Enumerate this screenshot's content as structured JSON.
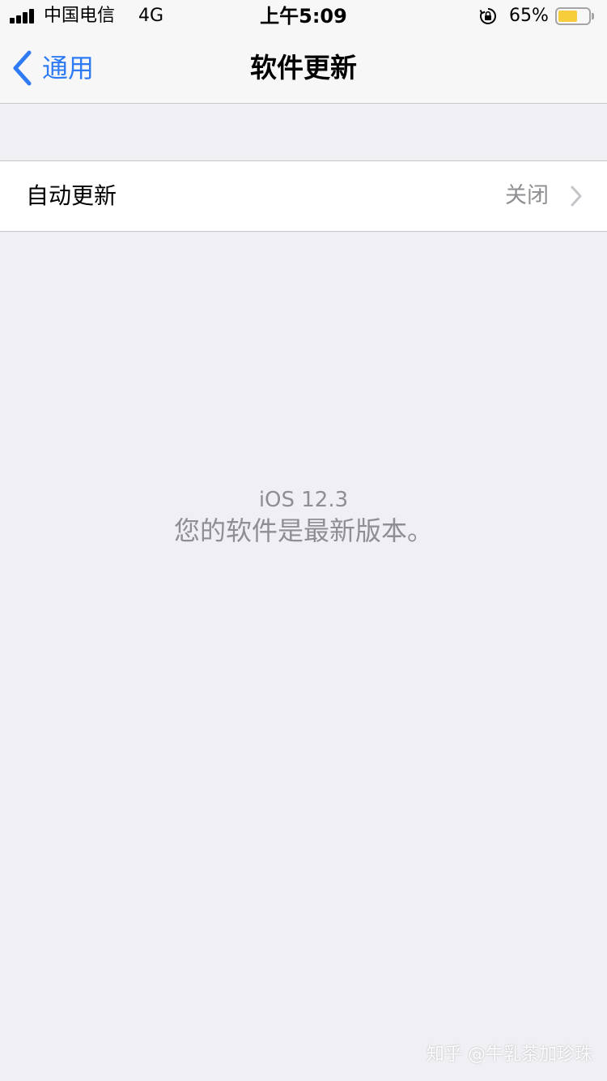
{
  "status_bar": {
    "carrier": "中国电信",
    "network": "4G",
    "time": "上午5:09",
    "battery_percent": "65%",
    "battery_level": 0.65,
    "battery_color": "#f7cd3c"
  },
  "nav_bar": {
    "back_label": "通用",
    "title": "软件更新",
    "accent_color": "#2f7bf5"
  },
  "settings": {
    "auto_update": {
      "label": "自动更新",
      "value": "关闭"
    }
  },
  "update_status": {
    "version": "iOS 12.3",
    "message": "您的软件是最新版本。"
  },
  "watermark": "知乎 @牛乳茶加珍珠",
  "icons": {
    "signal": "cellular-signal-icon",
    "orientation_lock": "orientation-lock-icon",
    "battery": "battery-icon",
    "back": "chevron-left-icon",
    "disclosure": "chevron-right-icon"
  }
}
